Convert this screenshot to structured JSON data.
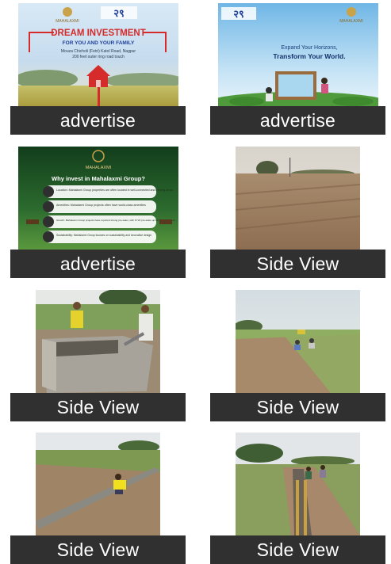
{
  "gallery": {
    "items": [
      {
        "caption": "advertise",
        "kind": "advert",
        "brand": "MAHALAXMI",
        "badge": "२९",
        "headline": "DREAM INVESTMENT",
        "subline": "FOR YOU AND YOUR FAMILY",
        "location_line1": "Mouza Chicholi (Fetri) Katol Road, Nagpur",
        "location_line2": "200 feet outer ring road touch"
      },
      {
        "caption": "advertise",
        "kind": "advert",
        "badge": "२९",
        "brand": "MAHALAXMI",
        "line1": "Expand Your Horizons,",
        "line2": "Transform Your World."
      },
      {
        "caption": "advertise",
        "kind": "advert",
        "brand": "MAHALAXMI",
        "headline": "Why invest in Mahalaxmi Group?",
        "points": [
          "Location: Mahalaxmi Group properties are often located in well-connected and thriving areas.",
          "Amenities: Mahalaxmi Group projects often have world-class amenities",
          "Growth: Mahalaxmi Group projects have reported strong pre-sales, with FY24 pre-sales up 84% year-on-year.",
          "Sustainability: Mahalaxmi Group focuses on sustainability and innovative design"
        ]
      },
      {
        "caption": "Side View",
        "kind": "photo",
        "scene": "graded-plot"
      },
      {
        "caption": "Side View",
        "kind": "photo",
        "scene": "water-tank"
      },
      {
        "caption": "Side View",
        "kind": "photo",
        "scene": "site-workers"
      },
      {
        "caption": "Side View",
        "kind": "photo",
        "scene": "boundary-work"
      },
      {
        "caption": "Side View",
        "kind": "photo",
        "scene": "drain-construction"
      }
    ]
  },
  "colors": {
    "caption_bg": "#303030",
    "caption_text": "#ffffff",
    "ad_red": "#d52b2b",
    "brand_gold": "#c9a24a"
  }
}
